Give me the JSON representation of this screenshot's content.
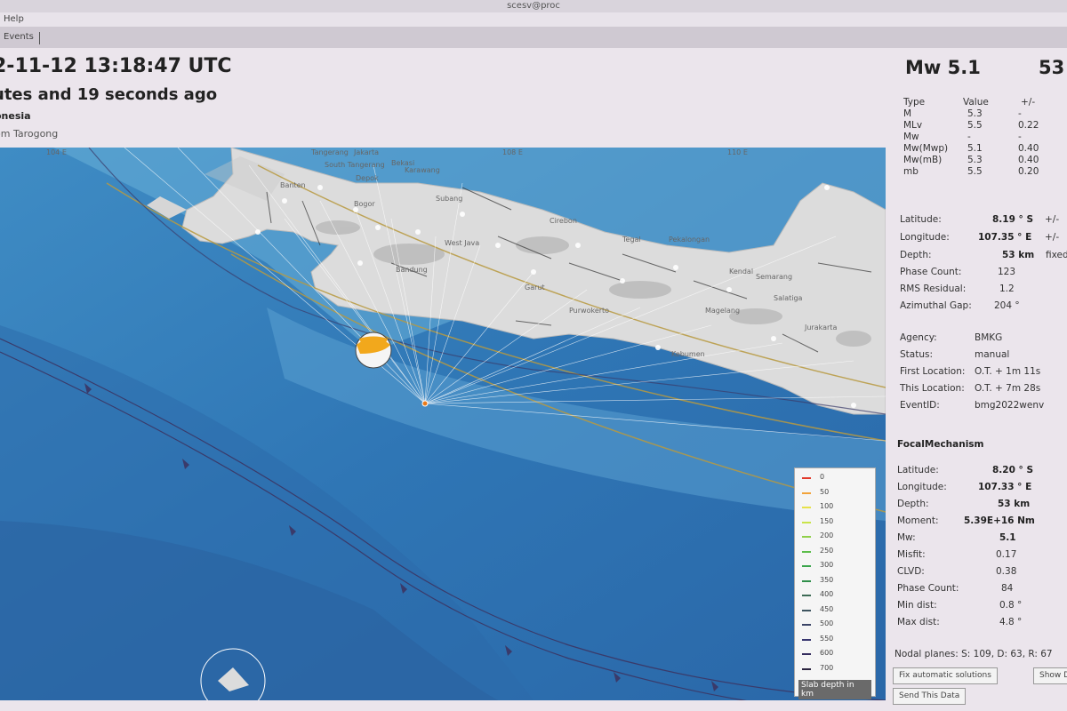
{
  "window": {
    "title": "scesv@proc"
  },
  "menu": {
    "help": "Help"
  },
  "tabs": {
    "events": "Events"
  },
  "event": {
    "time": "2-11-12 13:18:47 UTC",
    "ago": "utes and 19 seconds ago",
    "region": "onesia",
    "nearest": "om Tarogong"
  },
  "map": {
    "lon_labels": [
      "104 E",
      "108 E",
      "110 E"
    ],
    "cities": [
      "Tangerang",
      "Jakarta",
      "South Tangerang",
      "Bekasi",
      "Karawang",
      "Depok",
      "Bogor",
      "Banten",
      "Subang",
      "Cirebon",
      "Tegal",
      "Pekalongan",
      "Semarang",
      "Purwokerto",
      "Salatiga",
      "Magelang",
      "Jurakarta",
      "Kebumen",
      "West Java",
      "Bandung",
      "Garut",
      "Kendal"
    ]
  },
  "legend": {
    "title": "Slab depth in km",
    "entries": [
      {
        "label": "0",
        "color": "#e23a2c"
      },
      {
        "label": "50",
        "color": "#f2a33a"
      },
      {
        "label": "100",
        "color": "#e7e24a"
      },
      {
        "label": "150",
        "color": "#c9e44a"
      },
      {
        "label": "200",
        "color": "#8fd04a"
      },
      {
        "label": "250",
        "color": "#5cbd4a"
      },
      {
        "label": "300",
        "color": "#3aa54c"
      },
      {
        "label": "350",
        "color": "#2f8f4a"
      },
      {
        "label": "400",
        "color": "#3d6b55"
      },
      {
        "label": "450",
        "color": "#3f5560"
      },
      {
        "label": "500",
        "color": "#3b4467"
      },
      {
        "label": "550",
        "color": "#383670"
      },
      {
        "label": "600",
        "color": "#342c5e"
      },
      {
        "label": "700",
        "color": "#2b2440"
      }
    ]
  },
  "summary": {
    "magnitude": "Mw 5.1",
    "depth": "53"
  },
  "magnitudes": {
    "headers": {
      "type": "Type",
      "value": "Value",
      "unc": "+/-"
    },
    "rows": [
      {
        "type": "M",
        "value": "5.3",
        "unc": "-"
      },
      {
        "type": "MLv",
        "value": "5.5",
        "unc": "0.22"
      },
      {
        "type": "Mw",
        "value": "-",
        "unc": "-"
      },
      {
        "type": "Mw(Mwp)",
        "value": "5.1",
        "unc": "0.40"
      },
      {
        "type": "Mw(mB)",
        "value": "5.3",
        "unc": "0.40"
      },
      {
        "type": "mb",
        "value": "5.5",
        "unc": "0.20"
      }
    ]
  },
  "origin": {
    "latitude_label": "Latitude:",
    "latitude_value": "8.19 ° S",
    "latitude_unc": "+/-",
    "longitude_label": "Longitude:",
    "longitude_value": "107.35 ° E",
    "longitude_unc": "+/-",
    "depth_label": "Depth:",
    "depth_value": "53 km",
    "depth_status": "fixed",
    "phase_label": "Phase Count:",
    "phase_value": "123",
    "rms_label": "RMS Residual:",
    "rms_value": "1.2",
    "gap_label": "Azimuthal Gap:",
    "gap_value": "204 °"
  },
  "info": {
    "agency_label": "Agency:",
    "agency_value": "BMKG",
    "status_label": "Status:",
    "status_value": "manual",
    "first_label": "First Location:",
    "first_value": "O.T. + 1m 11s",
    "this_label": "This Location:",
    "this_value": "O.T. + 7m 28s",
    "eventid_label": "EventID:",
    "eventid_value": "bmg2022wenv"
  },
  "focal": {
    "title": "FocalMechanism",
    "latitude_label": "Latitude:",
    "latitude_value": "8.20 ° S",
    "longitude_label": "Longitude:",
    "longitude_value": "107.33 ° E",
    "depth_label": "Depth:",
    "depth_value": "53 km",
    "moment_label": "Moment:",
    "moment_value": "5.39E+16 Nm",
    "mw_label": "Mw:",
    "mw_value": "5.1",
    "misfit_label": "Misfit:",
    "misfit_value": "0.17",
    "clvd_label": "CLVD:",
    "clvd_value": "0.38",
    "phase_label": "Phase Count:",
    "phase_value": "84",
    "mindist_label": "Min dist:",
    "mindist_value": "0.8 °",
    "maxdist_label": "Max dist:",
    "maxdist_value": "4.8 °",
    "nodal": "Nodal planes: S: 109, D: 63, R: 67"
  },
  "buttons": {
    "fix": "Fix automatic solutions",
    "show": "Show D",
    "send": "Send This Data"
  }
}
